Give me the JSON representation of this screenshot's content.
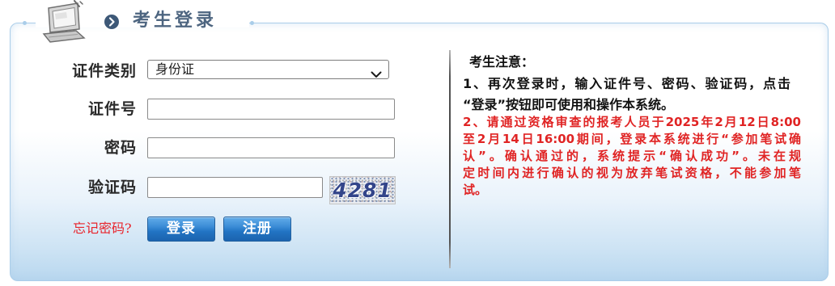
{
  "header": {
    "title": "考生登录",
    "icon": "computer-icon",
    "bullet_icon": "chevron-right-circle-icon"
  },
  "login_form": {
    "id_type_label": "证件类别",
    "id_type_value": "身份证",
    "id_type_icon": "chevron-down-icon",
    "id_number_label": "证件号",
    "password_label": "密码",
    "captcha_label": "验证码",
    "captcha_image_text": "4281",
    "forgot_password_link": "忘记密码?",
    "login_button": "登录",
    "register_button": "注册"
  },
  "notice": {
    "title": "考生注意：",
    "item1_lines": [
      "1、再次登录时，输入证件号、密码、验证码，点击",
      "“登录”按钮即可使用和操作本系统。"
    ],
    "item2_lines": [
      "2、请通过资格审查的报考人员于2025年2月12日8:00",
      "至2月14日16:00期间，登录本系统进行“参加笔试确",
      "认”。确认通过的，系统提示“确认成功”。未在规",
      "定时间内进行确认的视为放弃笔试资格，不能参加笔",
      "试。"
    ]
  },
  "theme": {
    "title": "#4d6580",
    "accent": "#2274c4",
    "alert": "#e02424",
    "link": "#e8232b",
    "panel-border": "#aacde9"
  }
}
